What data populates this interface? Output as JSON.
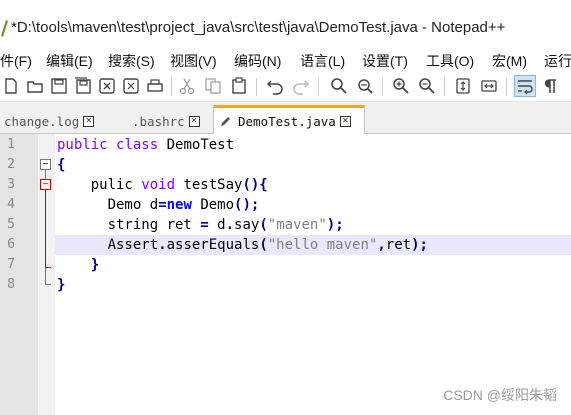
{
  "window": {
    "title": "*D:\\tools\\maven\\test\\project_java\\src\\test\\java\\DemoTest.java - Notepad++"
  },
  "menu": [
    {
      "label": "件(F)"
    },
    {
      "label": "编辑(E)"
    },
    {
      "label": "搜索(S)"
    },
    {
      "label": "视图(V)"
    },
    {
      "label": "编码(N)"
    },
    {
      "label": "语言(L)"
    },
    {
      "label": "设置(T)"
    },
    {
      "label": "工具(O)"
    },
    {
      "label": "宏(M)"
    },
    {
      "label": "运行"
    }
  ],
  "toolbar": {
    "icons": [
      "new-file-icon",
      "open-folder-icon",
      "save-icon",
      "save-all-icon",
      "close-icon",
      "close-all-icon",
      "print-icon",
      "cut-icon",
      "copy-icon",
      "paste-icon",
      "undo-icon",
      "redo-icon",
      "find-icon",
      "replace-icon",
      "zoom-in-icon",
      "zoom-out-icon",
      "sync-vertical-icon",
      "sync-horizontal-icon",
      "word-wrap-icon",
      "show-all-chars-icon"
    ]
  },
  "tabs": [
    {
      "label": "change.log",
      "active": false
    },
    {
      "label": ".bashrc",
      "active": false
    },
    {
      "label": "DemoTest.java",
      "active": true
    }
  ],
  "editor": {
    "line_numbers": [
      "1",
      "2",
      "3",
      "4",
      "5",
      "6",
      "7",
      "8"
    ],
    "current_line": 6,
    "lines": [
      {
        "indent": "",
        "tokens": [
          {
            "t": "kw",
            "v": "public"
          },
          {
            "t": "plain",
            "v": " "
          },
          {
            "t": "kw",
            "v": "class"
          },
          {
            "t": "plain",
            "v": " DemoTest"
          }
        ]
      },
      {
        "indent": "",
        "tokens": [
          {
            "t": "op",
            "v": "{"
          }
        ]
      },
      {
        "indent": "    ",
        "tokens": [
          {
            "t": "plain",
            "v": "pulic "
          },
          {
            "t": "kw",
            "v": "void"
          },
          {
            "t": "plain",
            "v": " testSay"
          },
          {
            "t": "op",
            "v": "(){"
          }
        ]
      },
      {
        "indent": "      ",
        "tokens": [
          {
            "t": "plain",
            "v": "Demo d"
          },
          {
            "t": "op",
            "v": "="
          },
          {
            "t": "kw2",
            "v": "new"
          },
          {
            "t": "plain",
            "v": " Demo"
          },
          {
            "t": "op",
            "v": "();"
          }
        ]
      },
      {
        "indent": "      ",
        "tokens": [
          {
            "t": "plain",
            "v": "string ret "
          },
          {
            "t": "op",
            "v": "="
          },
          {
            "t": "plain",
            "v": " d"
          },
          {
            "t": "op",
            "v": "."
          },
          {
            "t": "plain",
            "v": "say"
          },
          {
            "t": "op",
            "v": "("
          },
          {
            "t": "str",
            "v": "\"maven\""
          },
          {
            "t": "op",
            "v": ");"
          }
        ]
      },
      {
        "indent": "      ",
        "tokens": [
          {
            "t": "plain",
            "v": "Assert"
          },
          {
            "t": "op",
            "v": "."
          },
          {
            "t": "plain",
            "v": "asserEquals"
          },
          {
            "t": "op",
            "v": "("
          },
          {
            "t": "str",
            "v": "\"hello maven\""
          },
          {
            "t": "op",
            "v": ","
          },
          {
            "t": "plain",
            "v": "ret"
          },
          {
            "t": "op",
            "v": ");"
          }
        ]
      },
      {
        "indent": "    ",
        "tokens": [
          {
            "t": "op",
            "v": "}"
          }
        ]
      },
      {
        "indent": "",
        "tokens": [
          {
            "t": "op",
            "v": "}"
          }
        ]
      }
    ]
  },
  "watermark": "CSDN @绥阳朱韬",
  "colors": {
    "active_tab_accent": "#f6a623",
    "keyword": "#8000ff",
    "instruction_word": "#0000ff",
    "operator": "#000080",
    "string": "#808080",
    "current_line": "#e8e8ff",
    "fold_marker": "#cc0000"
  }
}
